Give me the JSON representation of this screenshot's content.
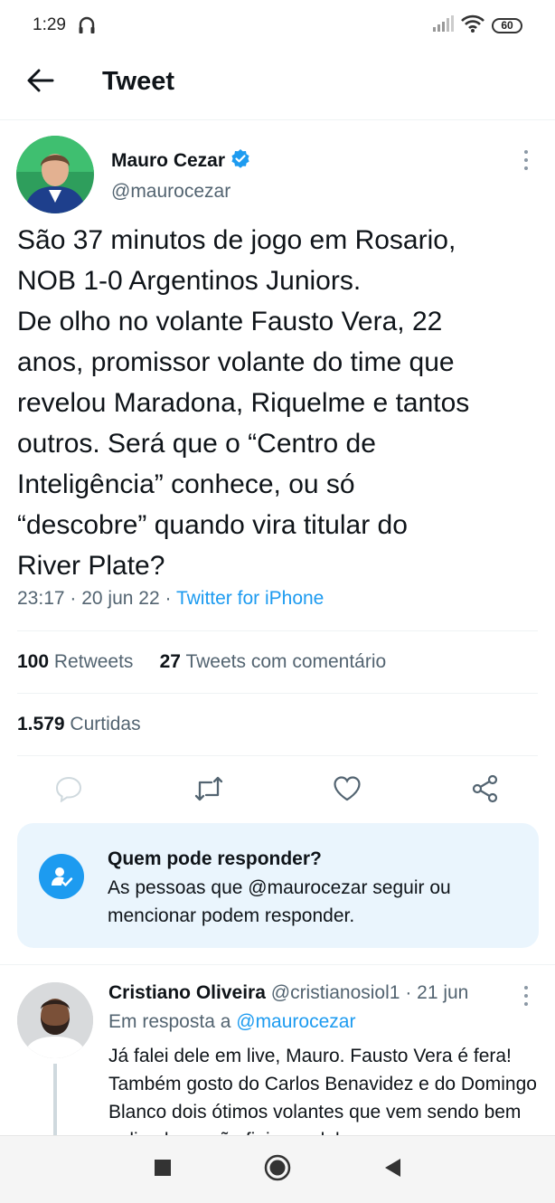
{
  "status_bar": {
    "time": "1:29",
    "battery": "60"
  },
  "header": {
    "title": "Tweet"
  },
  "tweet": {
    "author_name": "Mauro Cezar",
    "author_handle": "@maurocezar",
    "text_lines": [
      "São 37 minutos de jogo em Rosario,",
      "NOB 1-0 Argentinos Juniors.",
      "De olho no volante Fausto Vera, 22",
      "anos, promissor volante do time que",
      "revelou Maradona, Riquelme e tantos",
      "outros. Será que o “Centro de",
      "Inteligência” conhece, ou só",
      "“descobre” quando vira titular do",
      "River Plate?"
    ],
    "time": "23:17",
    "date": "20 jun 22",
    "source": "Twitter for iPhone",
    "retweets_count": "100",
    "retweets_label": "Retweets",
    "quotes_count": "27",
    "quotes_label": "Tweets com comentário",
    "likes_count": "1.579",
    "likes_label": "Curtidas"
  },
  "reply_restriction": {
    "title": "Quem pode responder?",
    "text": "As pessoas que @maurocezar seguir ou mencionar podem responder."
  },
  "reply": {
    "author_name": "Cristiano Oliveira",
    "author_handle": "@cristianosiol1",
    "date": "21 jun",
    "in_reply_label": "Em resposta a",
    "in_reply_to": "@maurocezar",
    "text": "Já falei dele em live, Mauro. Fausto Vera é fera! Também gosto do Carlos Benavidez e do Domingo Blanco dois ótimos volantes que vem sendo bem aplicados e são fieis ao clube."
  },
  "colors": {
    "accent": "#1d9bf0",
    "secondary_text": "#536471",
    "reply_box_bg": "#eaf5fd"
  }
}
